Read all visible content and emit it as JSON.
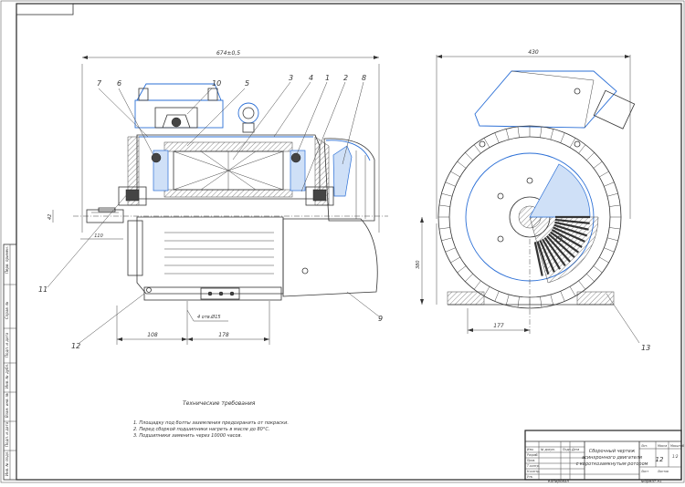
{
  "sheet": {
    "corner_box": "",
    "side_stamps": [
      "Подп. и дата",
      "Инв. № дубл.",
      "Взам. инв. №",
      "Подп. и дата",
      "Инв. № подл.",
      "Справ. №",
      "Перв. примен."
    ]
  },
  "front_view": {
    "overall_length": "674±0,5",
    "shaft_height": "42",
    "shaft_dim": "110",
    "mount_dim_1": "108",
    "mount_dim_2": "178",
    "holes_note": "4 отв.Ø15",
    "callouts": [
      "7",
      "6",
      "10",
      "5",
      "3",
      "4",
      "1",
      "2",
      "8",
      "11",
      "12",
      "9"
    ]
  },
  "side_view": {
    "width_dim": "430",
    "height_dim": "380",
    "base_dim": "177",
    "callouts": [
      "13"
    ]
  },
  "tech_requirements": {
    "heading": "Технические требования",
    "items": [
      "1. Площадку под болты заземления предохранить от покраски.",
      "2. Перед сборкой подшипники нагреть в масле до 80°С.",
      "3. Подшипники заменить через 10000 часов."
    ]
  },
  "title_block": {
    "title_line1": "Сборочный чертеж",
    "title_line2": "асинхронного двигателя",
    "title_line3": "с короткозамкнутым ротором",
    "sheet_label": "Лист",
    "sheets_label": "Листов",
    "number": "12",
    "col_headers": [
      "Изм.",
      "Лист",
      "№ докум.",
      "Подп.",
      "Дата"
    ],
    "row_labels": [
      "Разраб.",
      "Пров.",
      "Т.контр.",
      "Н.контр.",
      "Утв."
    ],
    "lit_label": "Лит.",
    "mass_label": "Масса",
    "scale_label": "Масштаб",
    "scale_value": "1:2"
  },
  "footer": {
    "copied": "Копировал",
    "format": "Формат A1"
  }
}
